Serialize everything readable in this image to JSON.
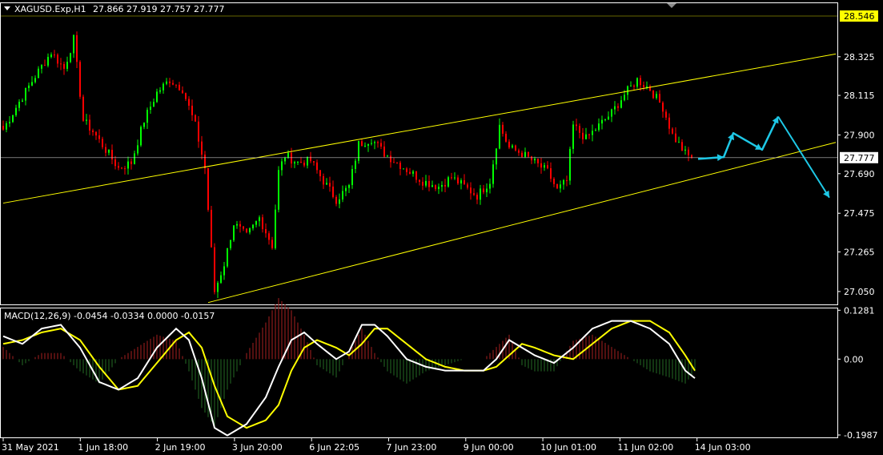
{
  "header": {
    "symbol": "XAGUSD.Exp,H1",
    "ohlc": "27.866 27.919 27.757 27.777"
  },
  "macd_header": {
    "label": "MACD(12,26,9) -0.0454 -0.0334 0.0000 -0.0157"
  },
  "colors": {
    "background": "#000000",
    "bull": "#00ff00",
    "bear": "#ff0000",
    "trendline": "#ffff00",
    "price_line": "#c0c0c0",
    "arrow": "#1ec8e6",
    "macd_main": "#ffffff",
    "macd_signal": "#ffff00",
    "hist_pos": "#8b1a1a",
    "hist_neg": "#1f5a1f"
  },
  "chart_data": [
    {
      "type": "candlestick",
      "symbol": "XAGUSD.Exp",
      "timeframe": "H1",
      "ylim": [
        26.98,
        28.62
      ],
      "y_ticks": [
        "28.325",
        "28.115",
        "27.900",
        "27.690",
        "27.475",
        "27.265",
        "27.050"
      ],
      "current_price": "27.777",
      "high_marker": "28.546",
      "x_labels": [
        "31 May 2021",
        "1 Jun 18:00",
        "2 Jun 19:00",
        "3 Jun 20:00",
        "6 Jun 22:05",
        "7 Jun 23:00",
        "9 Jun 00:00",
        "10 Jun 01:00",
        "11 Jun 02:00",
        "14 Jun 03:00"
      ],
      "keypoints": [
        [
          0,
          27.93
        ],
        [
          5,
          28.08
        ],
        [
          10,
          28.22
        ],
        [
          15,
          28.35
        ],
        [
          19,
          28.26
        ],
        [
          22,
          28.42
        ],
        [
          25,
          27.98
        ],
        [
          28,
          27.92
        ],
        [
          32,
          27.82
        ],
        [
          36,
          27.72
        ],
        [
          40,
          27.75
        ],
        [
          44,
          27.98
        ],
        [
          48,
          28.13
        ],
        [
          52,
          28.2
        ],
        [
          56,
          28.15
        ],
        [
          60,
          27.95
        ],
        [
          63,
          27.72
        ],
        [
          66,
          27.05
        ],
        [
          69,
          27.2
        ],
        [
          72,
          27.42
        ],
        [
          76,
          27.35
        ],
        [
          80,
          27.45
        ],
        [
          84,
          27.3
        ],
        [
          86,
          27.7
        ],
        [
          88,
          27.79
        ],
        [
          92,
          27.75
        ],
        [
          96,
          27.76
        ],
        [
          100,
          27.65
        ],
        [
          104,
          27.55
        ],
        [
          108,
          27.62
        ],
        [
          111,
          27.85
        ],
        [
          115,
          27.88
        ],
        [
          119,
          27.8
        ],
        [
          123,
          27.75
        ],
        [
          127,
          27.7
        ],
        [
          131,
          27.65
        ],
        [
          136,
          27.62
        ],
        [
          140,
          27.67
        ],
        [
          144,
          27.62
        ],
        [
          148,
          27.57
        ],
        [
          152,
          27.65
        ],
        [
          155,
          27.95
        ],
        [
          158,
          27.83
        ],
        [
          162,
          27.8
        ],
        [
          166,
          27.75
        ],
        [
          170,
          27.7
        ],
        [
          173,
          27.6
        ],
        [
          176,
          27.65
        ],
        [
          178,
          27.95
        ],
        [
          182,
          27.88
        ],
        [
          186,
          27.95
        ],
        [
          190,
          28.02
        ],
        [
          194,
          28.12
        ],
        [
          198,
          28.2
        ],
        [
          202,
          28.15
        ],
        [
          206,
          28.05
        ],
        [
          209,
          27.9
        ],
        [
          213,
          27.8
        ],
        [
          215,
          27.77
        ]
      ],
      "upper_channel": [
        [
          0,
          27.53
        ],
        [
          260,
          28.34
        ]
      ],
      "lower_channel": [
        [
          64,
          26.99
        ],
        [
          260,
          27.86
        ]
      ],
      "forecast_path": [
        [
          217,
          27.77
        ],
        [
          225,
          27.78
        ],
        [
          228,
          27.91
        ],
        [
          237,
          27.82
        ],
        [
          242,
          28.0
        ]
      ],
      "forecast_drop": [
        [
          242,
          28.0
        ],
        [
          258,
          27.56
        ]
      ]
    },
    {
      "type": "macd",
      "params": "12,26,9",
      "ylim": [
        -0.205,
        0.135
      ],
      "y_ticks": [
        "0.1281",
        "0.00",
        "-0.1987"
      ],
      "main_keypoints": [
        [
          0,
          0.06
        ],
        [
          6,
          0.04
        ],
        [
          12,
          0.08
        ],
        [
          18,
          0.09
        ],
        [
          24,
          0.03
        ],
        [
          30,
          -0.06
        ],
        [
          36,
          -0.08
        ],
        [
          42,
          -0.05
        ],
        [
          48,
          0.03
        ],
        [
          54,
          0.08
        ],
        [
          58,
          0.05
        ],
        [
          62,
          -0.05
        ],
        [
          66,
          -0.18
        ],
        [
          70,
          -0.2
        ],
        [
          76,
          -0.17
        ],
        [
          82,
          -0.1
        ],
        [
          86,
          -0.02
        ],
        [
          90,
          0.05
        ],
        [
          94,
          0.07
        ],
        [
          98,
          0.04
        ],
        [
          104,
          0.0
        ],
        [
          108,
          0.02
        ],
        [
          112,
          0.09
        ],
        [
          116,
          0.09
        ],
        [
          120,
          0.06
        ],
        [
          126,
          0.0
        ],
        [
          132,
          -0.02
        ],
        [
          138,
          -0.03
        ],
        [
          144,
          -0.03
        ],
        [
          150,
          -0.03
        ],
        [
          154,
          0.0
        ],
        [
          158,
          0.05
        ],
        [
          162,
          0.03
        ],
        [
          166,
          0.01
        ],
        [
          172,
          -0.01
        ],
        [
          178,
          0.03
        ],
        [
          184,
          0.08
        ],
        [
          190,
          0.1
        ],
        [
          196,
          0.1
        ],
        [
          202,
          0.08
        ],
        [
          208,
          0.04
        ],
        [
          213,
          -0.03
        ],
        [
          216,
          -0.05
        ]
      ],
      "signal_keypoints": [
        [
          0,
          0.04
        ],
        [
          6,
          0.05
        ],
        [
          12,
          0.07
        ],
        [
          18,
          0.08
        ],
        [
          24,
          0.05
        ],
        [
          30,
          -0.02
        ],
        [
          36,
          -0.08
        ],
        [
          42,
          -0.07
        ],
        [
          48,
          -0.01
        ],
        [
          54,
          0.05
        ],
        [
          58,
          0.07
        ],
        [
          62,
          0.03
        ],
        [
          66,
          -0.07
        ],
        [
          70,
          -0.15
        ],
        [
          76,
          -0.18
        ],
        [
          82,
          -0.16
        ],
        [
          86,
          -0.12
        ],
        [
          90,
          -0.03
        ],
        [
          94,
          0.03
        ],
        [
          98,
          0.05
        ],
        [
          104,
          0.03
        ],
        [
          108,
          0.01
        ],
        [
          112,
          0.04
        ],
        [
          116,
          0.08
        ],
        [
          120,
          0.08
        ],
        [
          126,
          0.04
        ],
        [
          132,
          0.0
        ],
        [
          138,
          -0.02
        ],
        [
          144,
          -0.03
        ],
        [
          150,
          -0.03
        ],
        [
          154,
          -0.02
        ],
        [
          158,
          0.01
        ],
        [
          162,
          0.04
        ],
        [
          166,
          0.03
        ],
        [
          172,
          0.01
        ],
        [
          178,
          0.0
        ],
        [
          184,
          0.04
        ],
        [
          190,
          0.08
        ],
        [
          196,
          0.1
        ],
        [
          202,
          0.1
        ],
        [
          208,
          0.07
        ],
        [
          213,
          0.01
        ],
        [
          216,
          -0.03
        ]
      ]
    }
  ]
}
